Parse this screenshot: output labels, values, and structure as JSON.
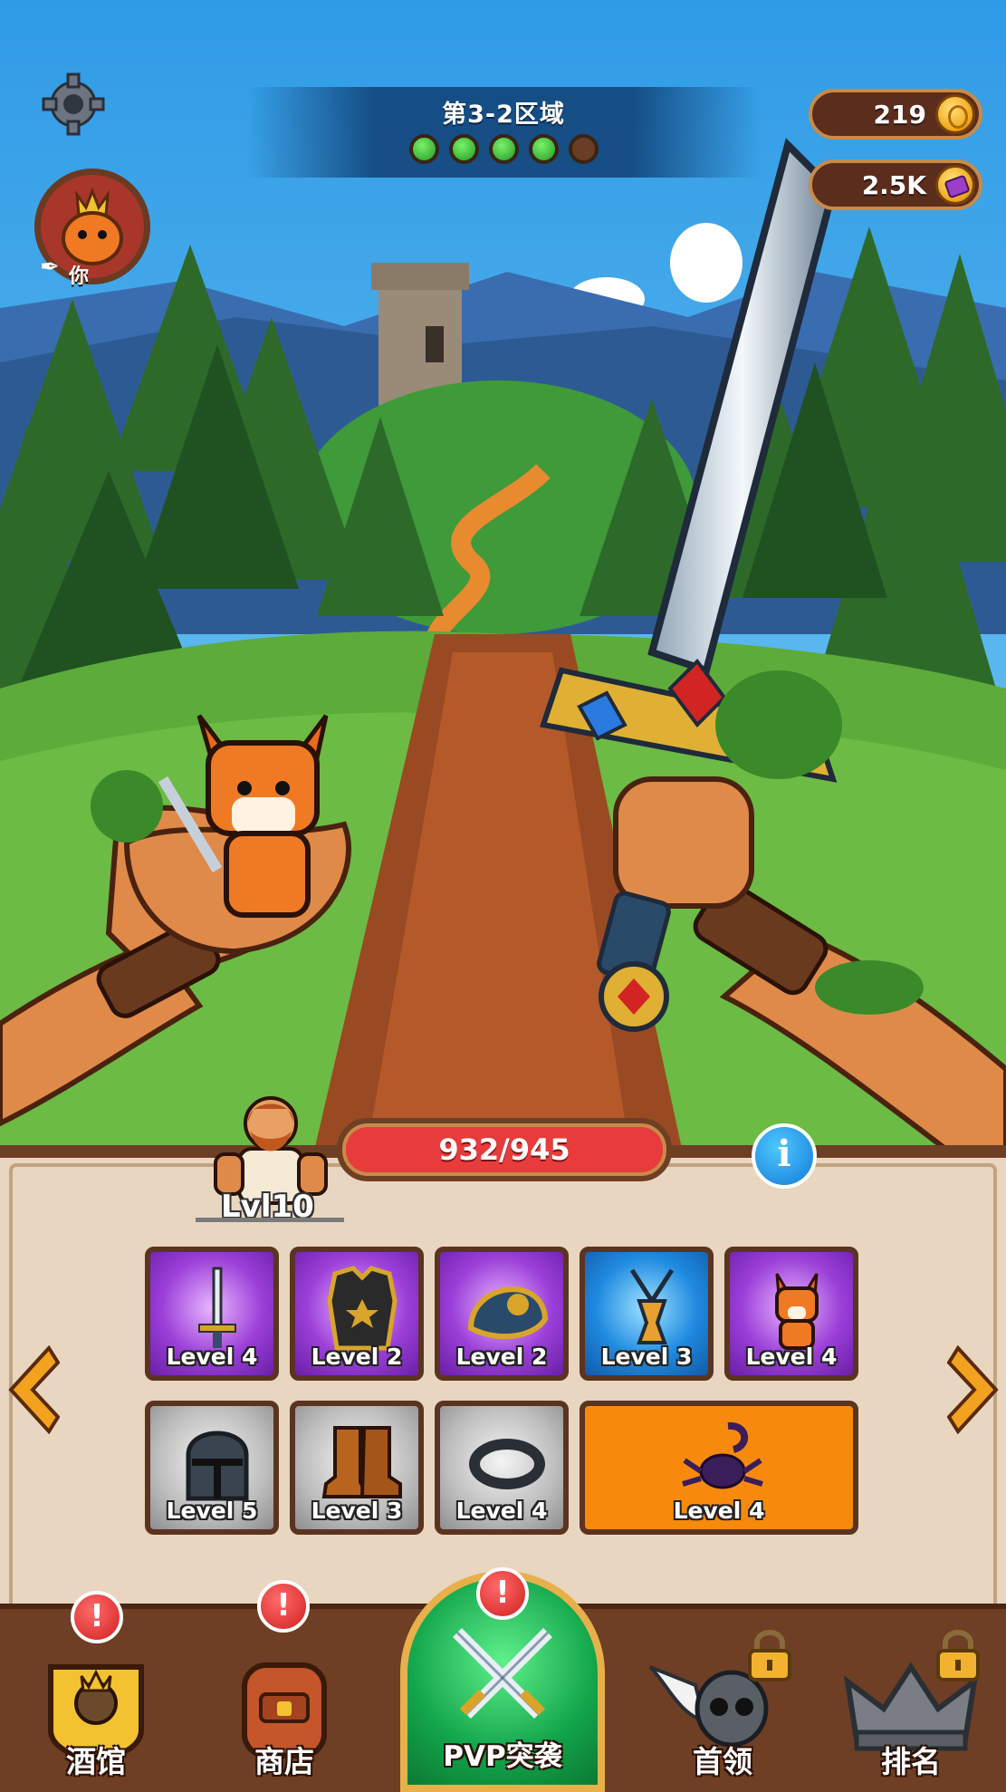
{
  "header": {
    "stage_title": "第3-2区域",
    "stage_progress": {
      "completed": 4,
      "total": 5
    }
  },
  "currency": {
    "gold": "219",
    "gems": "2.5K"
  },
  "player": {
    "avatar_label": "你"
  },
  "hero": {
    "hp_text": "932/945",
    "level_text": "Lvl10",
    "info_label": "i"
  },
  "equipment": {
    "row1": [
      {
        "name": "sword",
        "level": "Level 4",
        "rarity": "purple"
      },
      {
        "name": "chest-armor",
        "level": "Level 2",
        "rarity": "purple"
      },
      {
        "name": "shield",
        "level": "Level 2",
        "rarity": "purple"
      },
      {
        "name": "amulet",
        "level": "Level 3",
        "rarity": "blue"
      },
      {
        "name": "fox-pet",
        "level": "Level 4",
        "rarity": "purple"
      }
    ],
    "row2": [
      {
        "name": "helmet",
        "level": "Level 5",
        "rarity": "gray"
      },
      {
        "name": "boots",
        "level": "Level 3",
        "rarity": "gray"
      },
      {
        "name": "ring",
        "level": "Level 4",
        "rarity": "gray"
      },
      {
        "name": "scorpion-pet",
        "level": "Level 4",
        "rarity": "orange"
      }
    ]
  },
  "nav": {
    "tavern": "酒馆",
    "shop": "商店",
    "pvp": "PVP突袭",
    "boss": "首领",
    "ranking": "排名"
  },
  "colors": {
    "hp_bar": "#e83b3b",
    "panel_bg": "#e8d6c0",
    "frame": "#6e3f24",
    "pvp_button": "#12a44a",
    "rare_purple": "#9b3fd8",
    "rare_blue": "#1f8ae0",
    "common_gray": "#bdbdbd",
    "legendary_orange": "#f78a0c"
  }
}
